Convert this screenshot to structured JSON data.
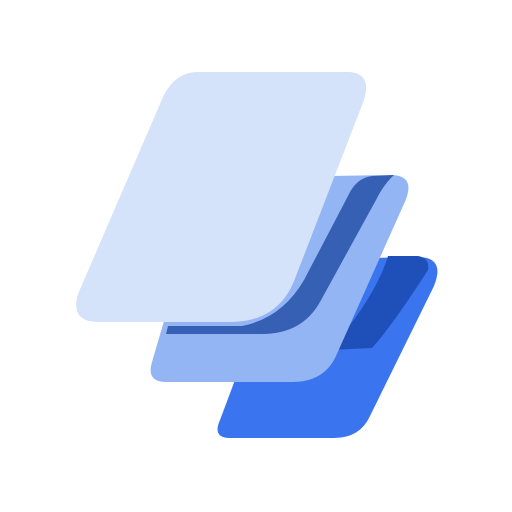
{
  "logo": {
    "icon": "stacked-layers-icon",
    "colors": {
      "background": "#FFFFFF",
      "layer_back": "#3A75EF",
      "layer_back_shadow": "#1F4FB8",
      "layer_middle": "#93B5F4",
      "layer_middle_shadow": "#3660B4",
      "layer_front": "#D4E2FA"
    }
  }
}
